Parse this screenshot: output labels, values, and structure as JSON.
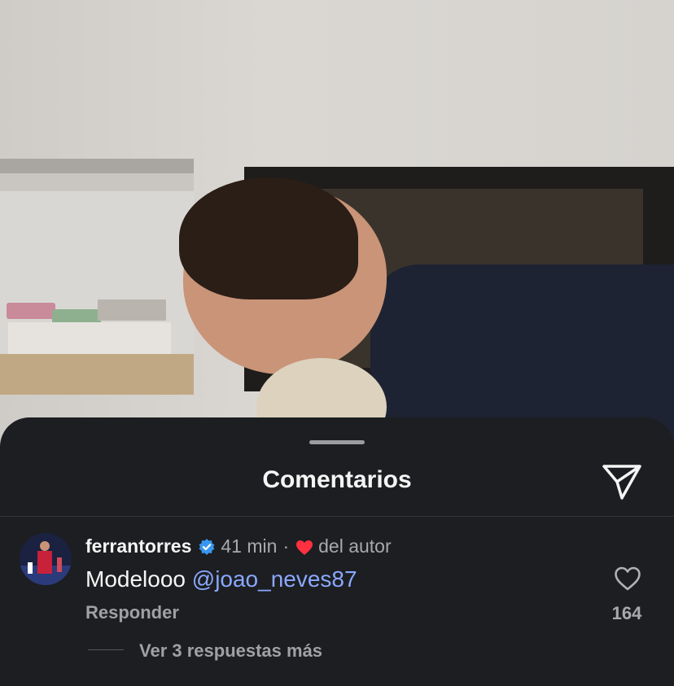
{
  "sheet": {
    "title": "Comentarios",
    "send_icon": "send-icon"
  },
  "comment": {
    "username": "ferrantorres",
    "verified_icon": "verified-badge-icon",
    "time": "41 min",
    "separator": "·",
    "author_like_icon": "heart-filled-icon",
    "author_like_label": "del autor",
    "text": "Modelooo ",
    "mention": "@joao_neves87",
    "reply_label": "Responder",
    "like_icon": "heart-outline-icon",
    "like_count": "164",
    "view_replies_label": "Ver 3 respuestas más"
  },
  "colors": {
    "sheet_bg": "#1c1e21",
    "mention": "#8aa8ff",
    "verified": "#3897f0",
    "author_heart": "#ff3040"
  }
}
